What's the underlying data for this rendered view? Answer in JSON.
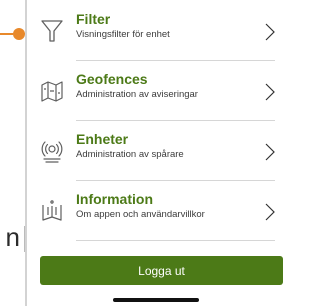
{
  "background": {
    "partial_text": "n"
  },
  "menu": {
    "items": [
      {
        "title": "Filter",
        "subtitle": "Visningsfilter för enhet",
        "icon": "filter-icon"
      },
      {
        "title": "Geofences",
        "subtitle": "Administration av aviseringar",
        "icon": "map-icon"
      },
      {
        "title": "Enheter",
        "subtitle": "Administration av spårare",
        "icon": "tracker-icon"
      },
      {
        "title": "Information",
        "subtitle": "Om appen och användarvillkor",
        "icon": "info-book-icon"
      }
    ],
    "chevron_icon": "chevron-right-icon"
  },
  "logout": {
    "label": "Logga ut"
  },
  "colors": {
    "accent_orange": "#e8892b",
    "brand_green": "#4c7a17",
    "icon_gray": "#5f5f5f"
  }
}
